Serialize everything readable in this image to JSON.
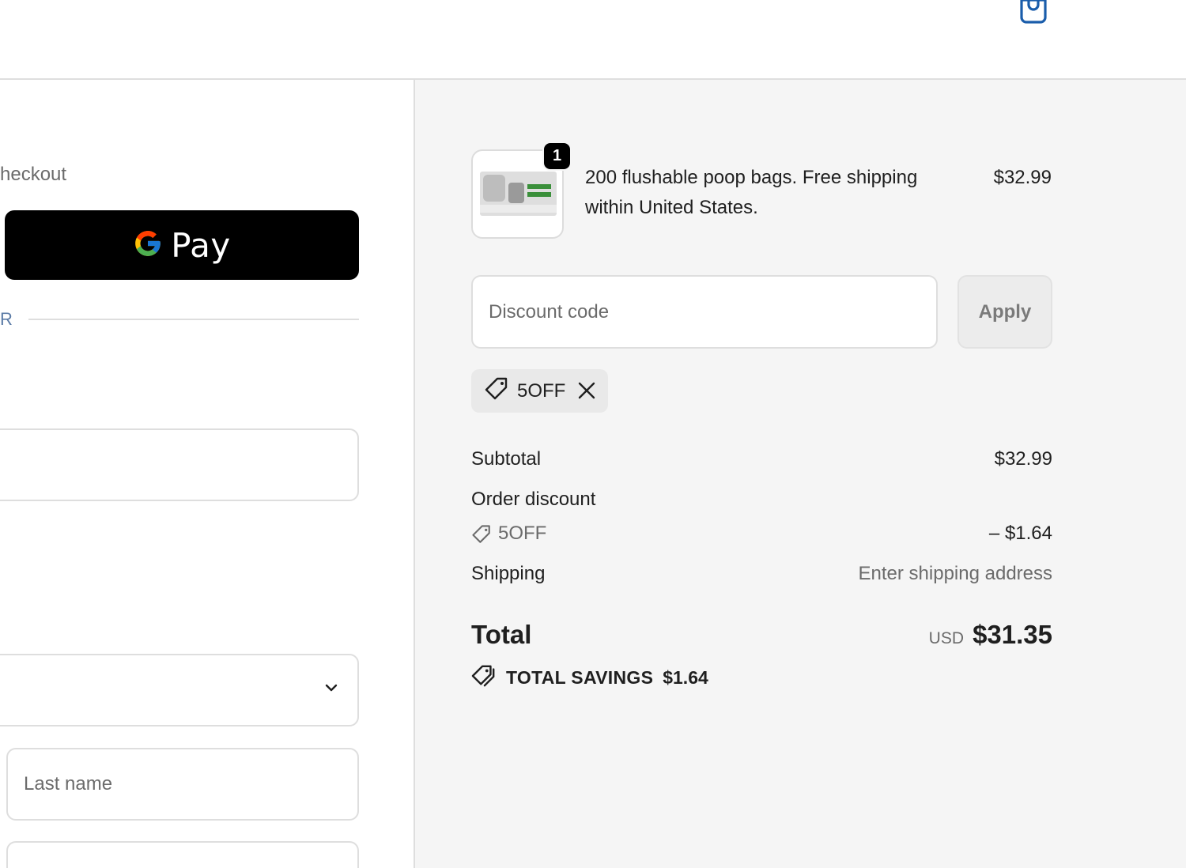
{
  "header": {
    "cart_icon": "shopping-bag-icon"
  },
  "left": {
    "express_label": "heckout",
    "gpay": {
      "label": "Pay",
      "icon": "google-g-icon"
    },
    "or_label": "R",
    "email": {
      "value": "",
      "placeholder": ""
    },
    "country": {
      "value": "",
      "icon": "chevron-down-icon"
    },
    "last_name": {
      "placeholder": "Last name"
    },
    "next_field": {
      "value": ""
    }
  },
  "summary": {
    "product": {
      "quantity": "1",
      "name": "200 flushable poop bags. Free shipping within United States.",
      "price": "$32.99"
    },
    "discount": {
      "placeholder": "Discount code",
      "apply_label": "Apply"
    },
    "applied_code": {
      "code": "5OFF",
      "icon": "tag-icon",
      "remove_icon": "close-icon"
    },
    "subtotal": {
      "label": "Subtotal",
      "value": "$32.99"
    },
    "order_discount": {
      "label": "Order discount",
      "code": "5OFF",
      "value": "– $1.64"
    },
    "shipping": {
      "label": "Shipping",
      "value": "Enter shipping address"
    },
    "total": {
      "label": "Total",
      "currency": "USD",
      "amount": "$31.35"
    },
    "savings": {
      "label": "TOTAL SAVINGS",
      "amount": "$1.64",
      "icon": "tags-icon"
    }
  },
  "colors": {
    "accent": "#1a5dab",
    "button": "#000000",
    "summary_bg": "#f5f5f5"
  }
}
